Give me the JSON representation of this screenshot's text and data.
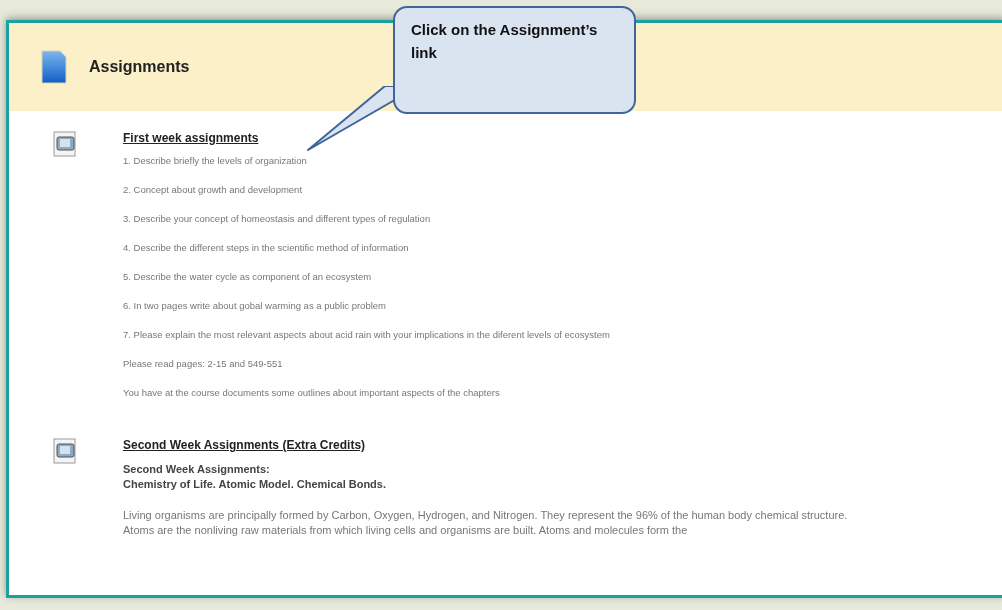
{
  "page": {
    "title": "Assignments"
  },
  "callout": {
    "text": "Click on the Assignment’s link"
  },
  "items": [
    {
      "title": "First week assignments",
      "lines": [
        "1. Describe briefly the levels of organization",
        "2. Concept about growth and development",
        "3. Describe your concept of homeostasis and different types of regulation",
        "4. Describe the different steps in the scientific method of information",
        "5. Describe the water cycle as component of an ecosystem",
        "6. In two pages write about gobal warming  as a public problem",
        "7. Please explain the most relevant aspects  about acid rain with your implications in the diferent levels of ecosystem",
        "Please read pages: 2-15 and 549-551",
        "You have at the course documents some outlines about important aspects of the chapters"
      ]
    },
    {
      "title": "Second Week Assignments (Extra Credits)",
      "subtitle": [
        "Second Week Assignments:",
        "Chemistry of Life. Atomic Model. Chemical Bonds."
      ],
      "paragraphs": [
        "Living organisms are principally formed by Carbon, Oxygen, Hydrogen, and Nitrogen. They represent the 96% of the human body chemical structure.",
        "Atoms are the nonliving raw materials from which living cells and organisms are built. Atoms and molecules form the"
      ]
    }
  ]
}
